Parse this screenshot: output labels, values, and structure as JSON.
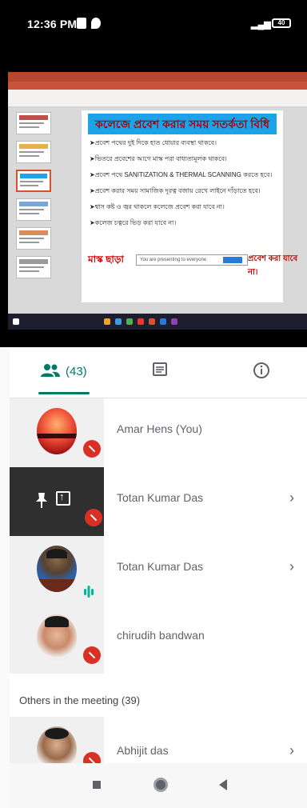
{
  "status_bar": {
    "time": "12:36 PM",
    "signal": "4G",
    "battery": "40"
  },
  "shared_screen": {
    "slide_title": "কলেজে প্রবেশ করার সময় সতর্কতা বিধি",
    "bullets": [
      "প্রবেশ পথের দুই দিকে হাত ধোয়ার ব্যবস্থা থাকবে।",
      "ভিতরে প্রবেশের আগে মাস্ক পরা বাধ্যতামূলক থাকবে।",
      "প্রবেশ পথে SANITIZATION & THERMAL SCANNING করতে হবে।",
      "প্রবেশ করার সময় সামাজিক দূরত্ব বজায় রেখে লাইনে দাঁড়াতে হবে।",
      "শ্বাস কষ্ট ও জ্বর থাকলে কলেজে প্রবেশ করা যাবে না।",
      "কলেজ চত্বরে ভিড় করা যাবে না।"
    ],
    "footer_left": "মাস্ক ছাড়া",
    "footer_right": "প্রবেশ করা যাবে না।",
    "popup_text": "You are presenting to everyone",
    "accent": "#1ca3e8"
  },
  "tabs": {
    "people_count": "(43)",
    "people_icon": "people-icon",
    "chat_icon": "chat-icon",
    "info_icon": "info-icon",
    "active_color": "#00796b"
  },
  "participants": [
    {
      "name": "Amar Hens (You)",
      "muted": true
    },
    {
      "name": "Totan Kumar Das",
      "muted": true,
      "presenting": true
    },
    {
      "name": "Totan Kumar Das",
      "speaking": true
    },
    {
      "name": "chirudih bandwan",
      "muted": true
    }
  ],
  "others_section": {
    "label": "Others in the meeting (39)"
  },
  "others": [
    {
      "name": "Abhijit das",
      "muted": true
    }
  ],
  "colors": {
    "mute_red": "#d93025",
    "teal": "#00796b"
  }
}
